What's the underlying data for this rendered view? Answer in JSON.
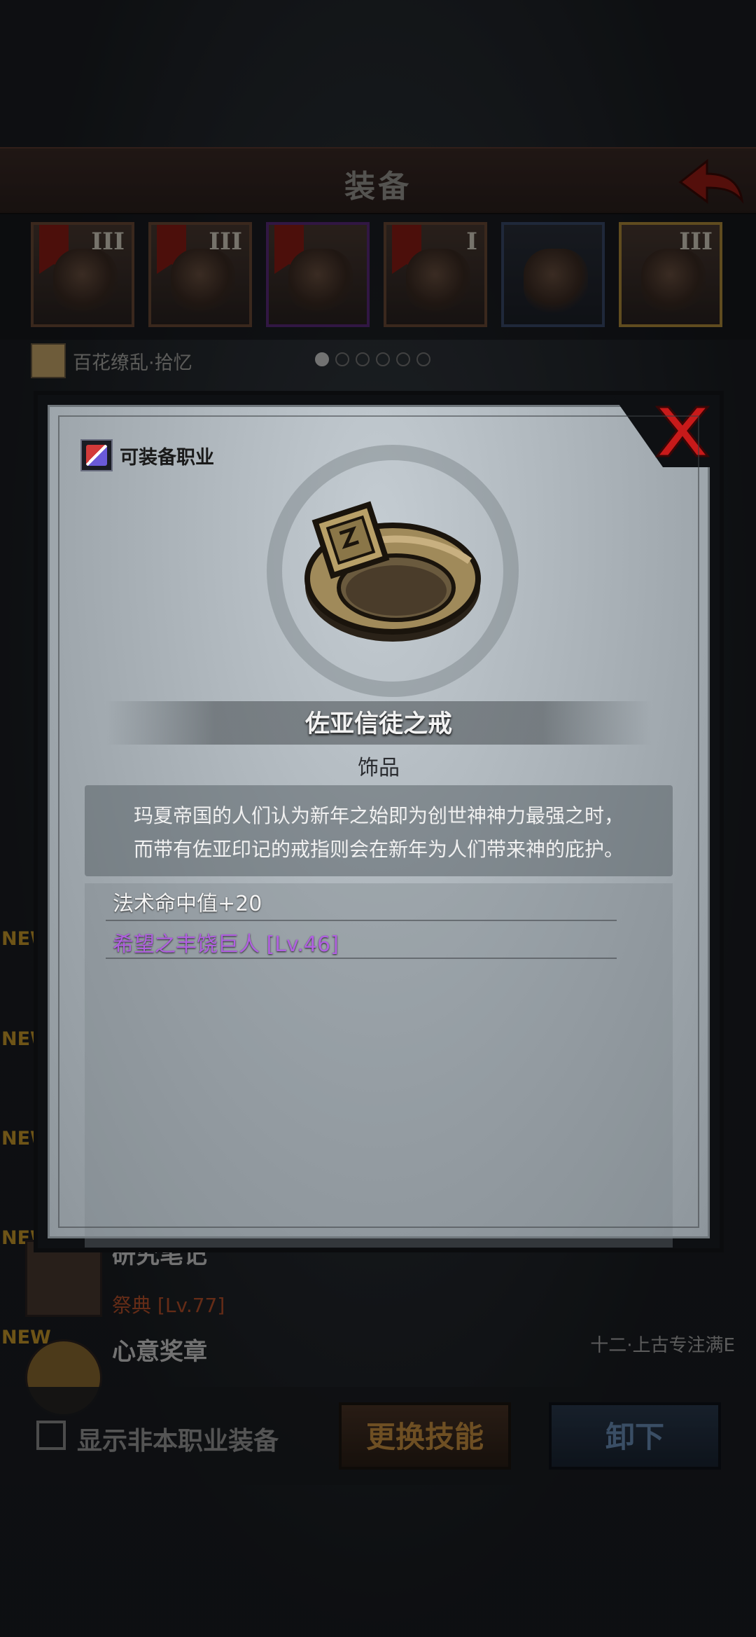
{
  "header": {
    "title": "装备"
  },
  "slots": [
    {
      "rank": "III"
    },
    {
      "rank": "III"
    },
    {
      "rank": ""
    },
    {
      "rank": "I"
    },
    {
      "rank": ""
    },
    {
      "rank": "III"
    }
  ],
  "hero": {
    "name": "百花缭乱·拾忆"
  },
  "list": [
    {
      "new": "NEW",
      "title": "研究笔记",
      "sub": "祭典 [Lv.77]",
      "right": ""
    },
    {
      "new": "NEW",
      "title": "心意奖章",
      "sub": "",
      "right": "十二·上古专注满E"
    }
  ],
  "bottom": {
    "checkbox_label": "显示非本职业装备",
    "skill_button": "更换技能",
    "remove_button": "卸下"
  },
  "modal": {
    "class_label": "可装备职业",
    "item_name": "佐亚信徒之戒",
    "item_type": "饰品",
    "description": [
      "玛夏帝国的人们认为新年之始即为创世神神力最强之时，",
      "而带有佐亚印记的戒指则会在新年为人们带来神的庇护。"
    ],
    "stat_1": "法术命中值+20",
    "stat_2": "希望之丰饶巨人 [Lv.46]"
  },
  "colors": {
    "accent_red": "#c81a1a",
    "stat_purple": "#b060e0",
    "new_tag": "#c99a2a"
  }
}
